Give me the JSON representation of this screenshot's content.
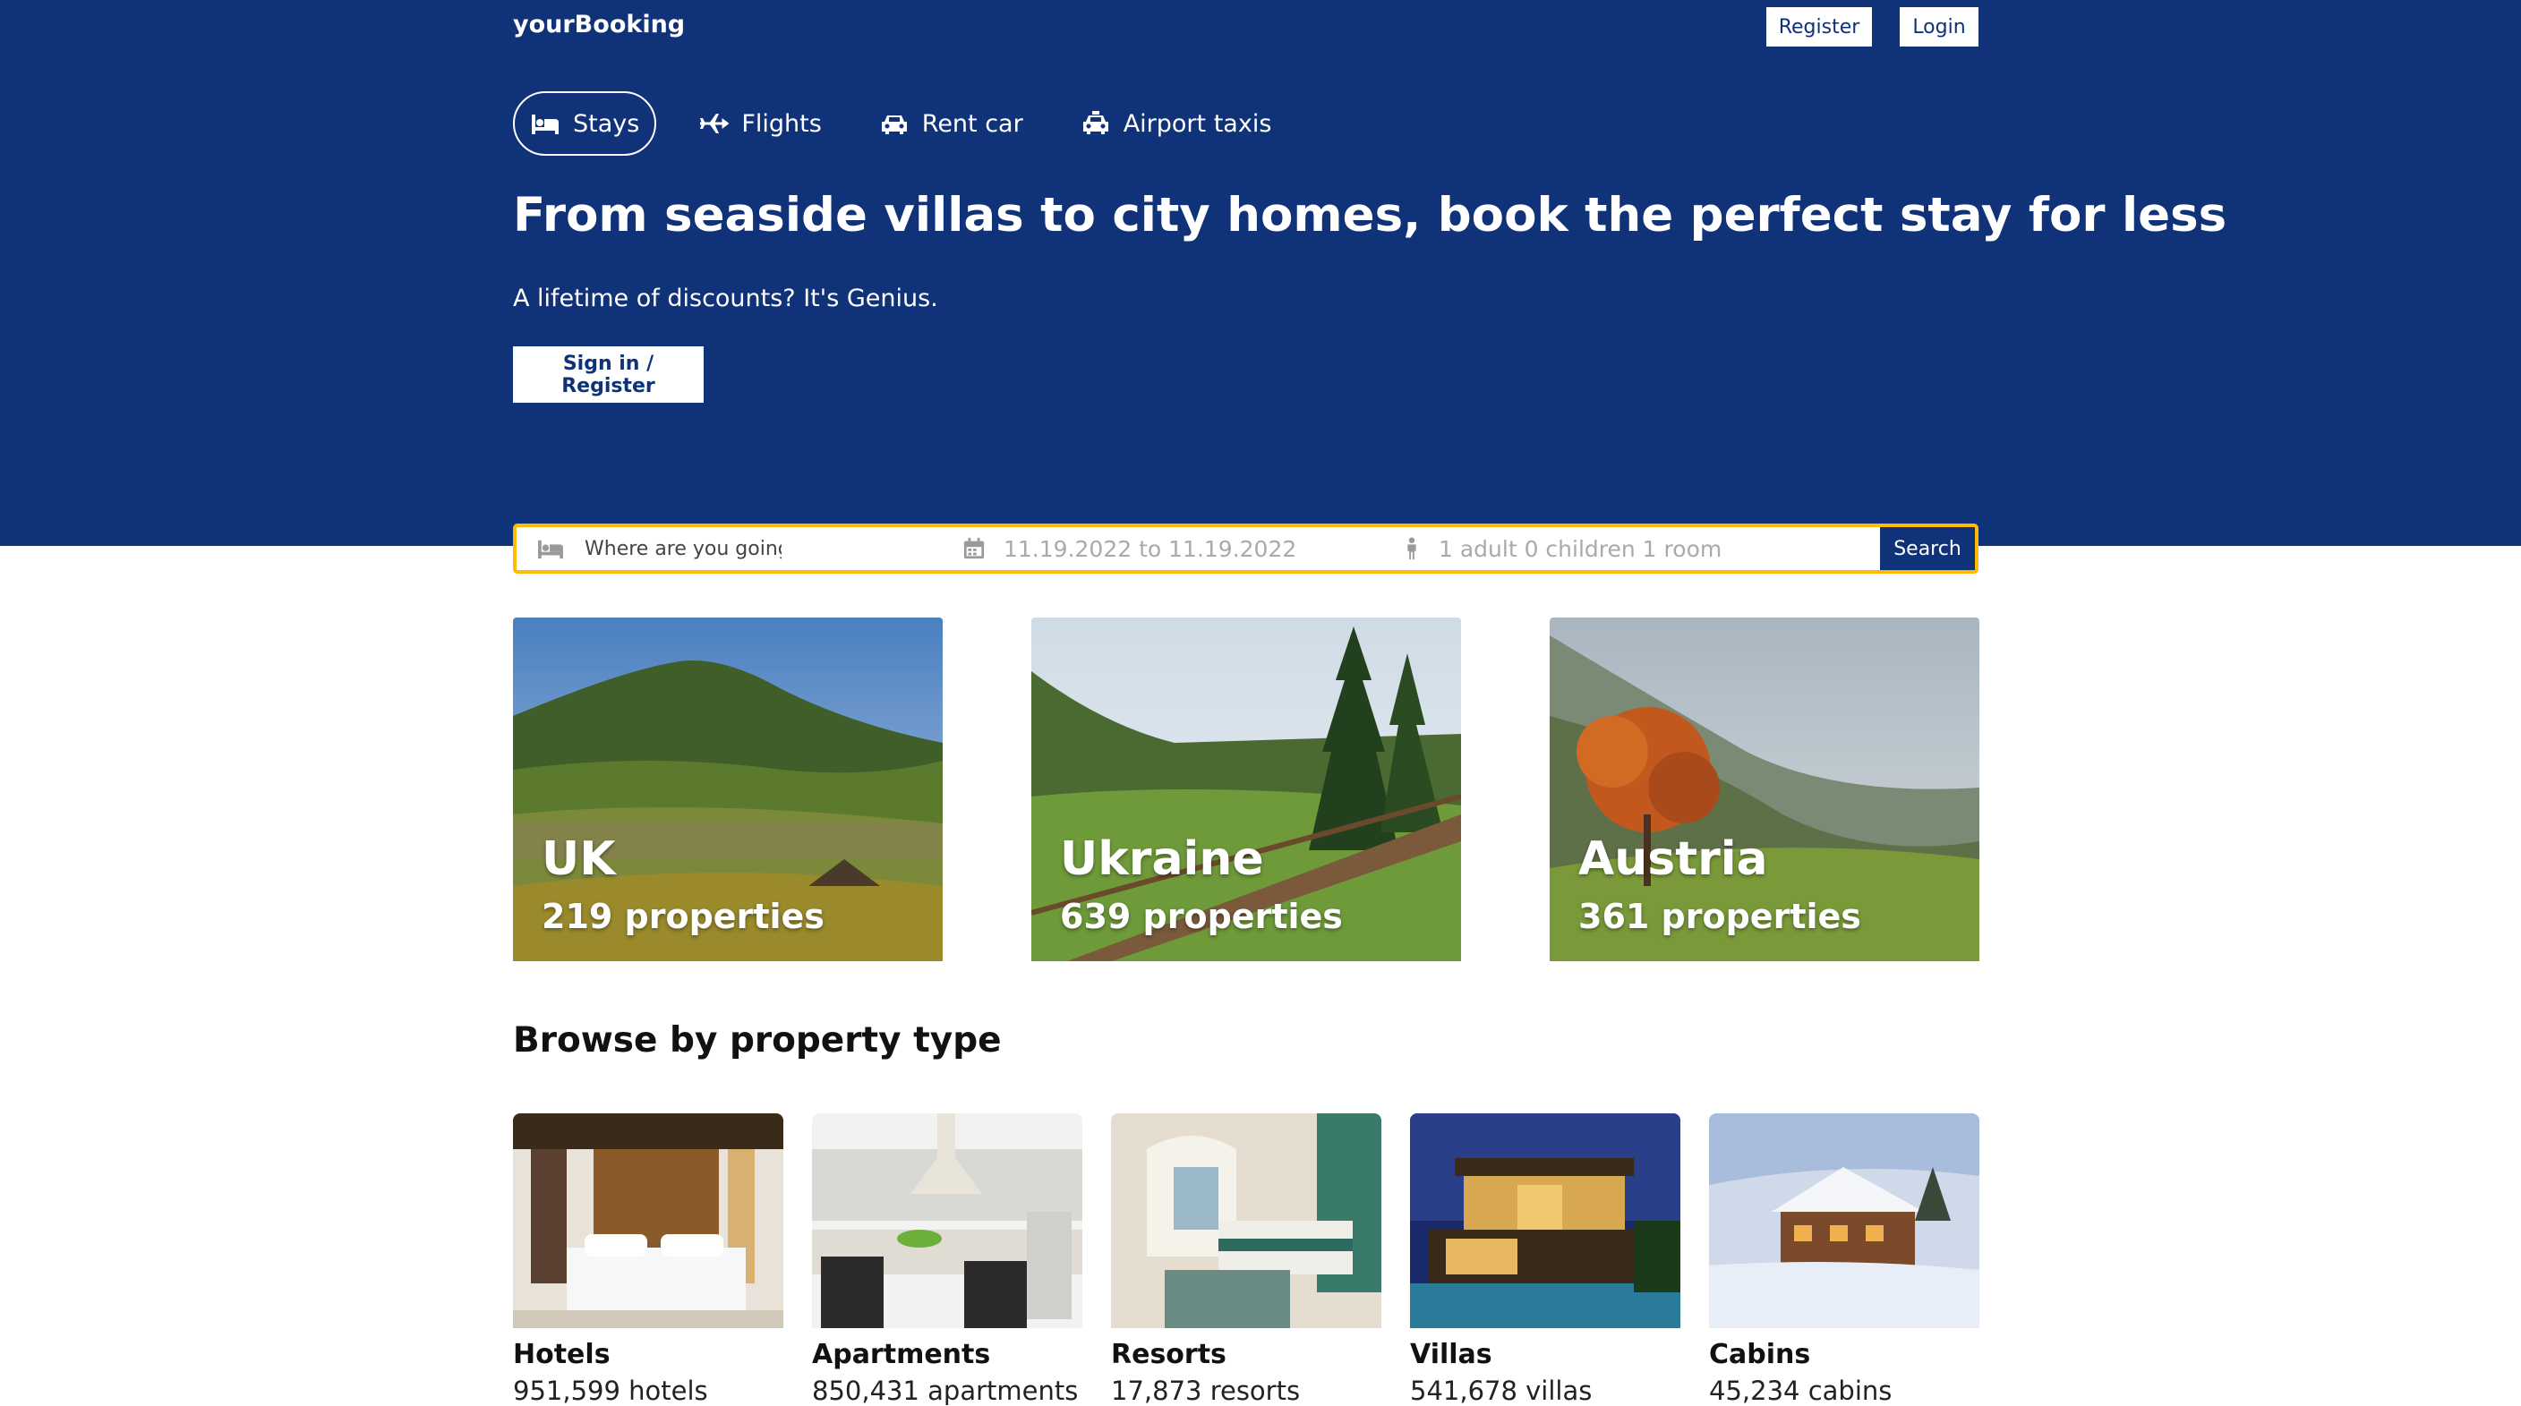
{
  "header": {
    "logo": "yourBooking",
    "register_label": "Register",
    "login_label": "Login"
  },
  "tabs": [
    {
      "label": "Stays",
      "icon": "bed-icon",
      "active": true
    },
    {
      "label": "Flights",
      "icon": "plane-icon",
      "active": false
    },
    {
      "label": "Rent car",
      "icon": "car-icon",
      "active": false
    },
    {
      "label": "Airport taxis",
      "icon": "taxi-icon",
      "active": false
    }
  ],
  "hero": {
    "headline": "From seaside villas to city homes, book the perfect stay for less",
    "subtitle": "A lifetime of discounts? It's Genius.",
    "signin_label": "Sign in / Register"
  },
  "search": {
    "destination_placeholder": "Where are you going?",
    "dates": "11.19.2022 to 11.19.2022",
    "guests": "1 adult 0 children 1 room",
    "button_label": "Search"
  },
  "featured": [
    {
      "title": "UK",
      "count": "219 properties"
    },
    {
      "title": "Ukraine",
      "count": "639 properties"
    },
    {
      "title": "Austria",
      "count": "361 properties"
    }
  ],
  "property_section": {
    "title": "Browse by property type",
    "items": [
      {
        "name": "Hotels",
        "count": "951,599 hotels"
      },
      {
        "name": "Apartments",
        "count": "850,431 apartments"
      },
      {
        "name": "Resorts",
        "count": "17,873 resorts"
      },
      {
        "name": "Villas",
        "count": "541,678 villas"
      },
      {
        "name": "Cabins",
        "count": "45,234 cabins"
      }
    ]
  },
  "colors": {
    "brand": "#0f3278",
    "search_border": "#febb02"
  }
}
